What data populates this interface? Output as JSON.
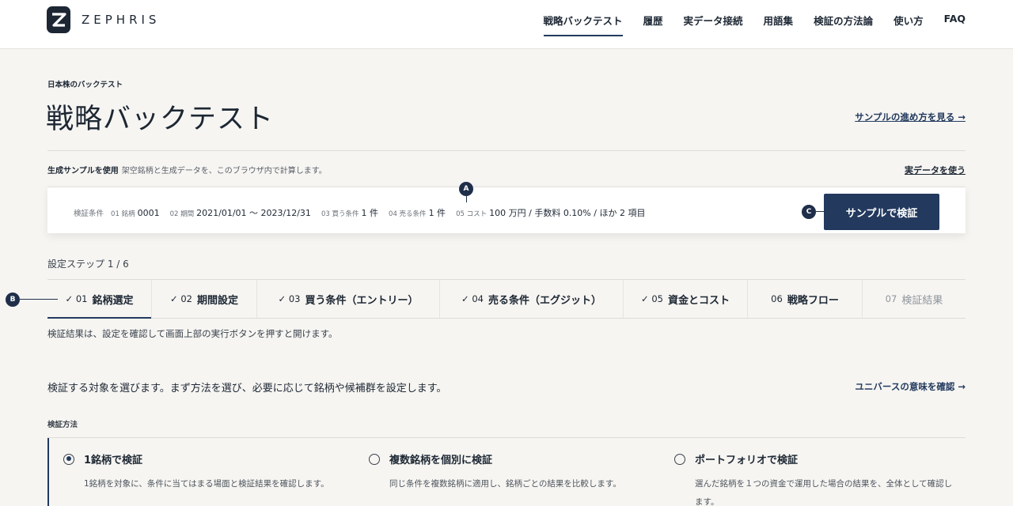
{
  "brand": {
    "name": "ZEPHRIS",
    "logo_icon": "zephris-logo-icon"
  },
  "nav": {
    "items": [
      {
        "label": "戦略バックテスト",
        "active": true
      },
      {
        "label": "履歴"
      },
      {
        "label": "実データ接続"
      },
      {
        "label": "用語集"
      },
      {
        "label": "検証の方法論"
      },
      {
        "label": "使い方"
      },
      {
        "label": "FAQ"
      }
    ]
  },
  "header": {
    "eyebrow": "日本株のバックテスト",
    "title": "戦略バックテスト",
    "sample_link": "サンプルの進め方を見る →"
  },
  "mode": {
    "label": "生成サンプルを使用",
    "description": "架空銘柄と生成データを、このブラウザ内で計算します。",
    "realdata_link": "実データを使う"
  },
  "conditions": {
    "title": "検証条件",
    "items": [
      {
        "key": "01 銘柄",
        "value": "0001"
      },
      {
        "key": "02 期間",
        "value": "2021/01/01 〜 2023/12/31"
      },
      {
        "key": "03 買う条件",
        "value": "1 件"
      },
      {
        "key": "04 売る条件",
        "value": "1 件"
      },
      {
        "key": "05 コスト",
        "value": "100 万円 / 手数料 0.10% / ほか 2 項目"
      }
    ],
    "run_button": "サンプルで検証"
  },
  "annotations": {
    "a": "A",
    "b": "B",
    "c": "C"
  },
  "steps": {
    "label": "設定ステップ 1 / 6",
    "tabs": [
      {
        "check": "✓",
        "num": "01",
        "title": "銘柄選定",
        "state": "active"
      },
      {
        "check": "✓",
        "num": "02",
        "title": "期間設定",
        "state": "done"
      },
      {
        "check": "✓",
        "num": "03",
        "title": "買う条件（エントリー）",
        "state": "done"
      },
      {
        "check": "✓",
        "num": "04",
        "title": "売る条件（エグジット）",
        "state": "done"
      },
      {
        "check": "✓",
        "num": "05",
        "title": "資金とコスト",
        "state": "done"
      },
      {
        "check": "",
        "num": "06",
        "title": "戦略フロー",
        "state": "next"
      },
      {
        "check": "",
        "num": "07",
        "title": "検証結果",
        "state": "locked"
      }
    ],
    "result_note": "検証結果は、設定を確認して画面上部の実行ボタンを押すと開けます。"
  },
  "section": {
    "description": "検証する対象を選びます。まず方法を選び、必要に応じて銘柄や候補群を設定します。",
    "universe_link": "ユニバースの意味を確認 →"
  },
  "method": {
    "label": "検証方法",
    "options": [
      {
        "title": "1銘柄で検証",
        "body": "1銘柄を対象に、条件に当てはまる場面と検証結果を確認します。",
        "selected": true
      },
      {
        "title": "複数銘柄を個別に検証",
        "body": "同じ条件を複数銘柄に適用し、銘柄ごとの結果を比較します。",
        "selected": false
      },
      {
        "title": "ポートフォリオで検証",
        "body": "選んだ銘柄を１つの資金で運用した場合の結果を、全体として確認します。",
        "selected": false
      }
    ]
  }
}
